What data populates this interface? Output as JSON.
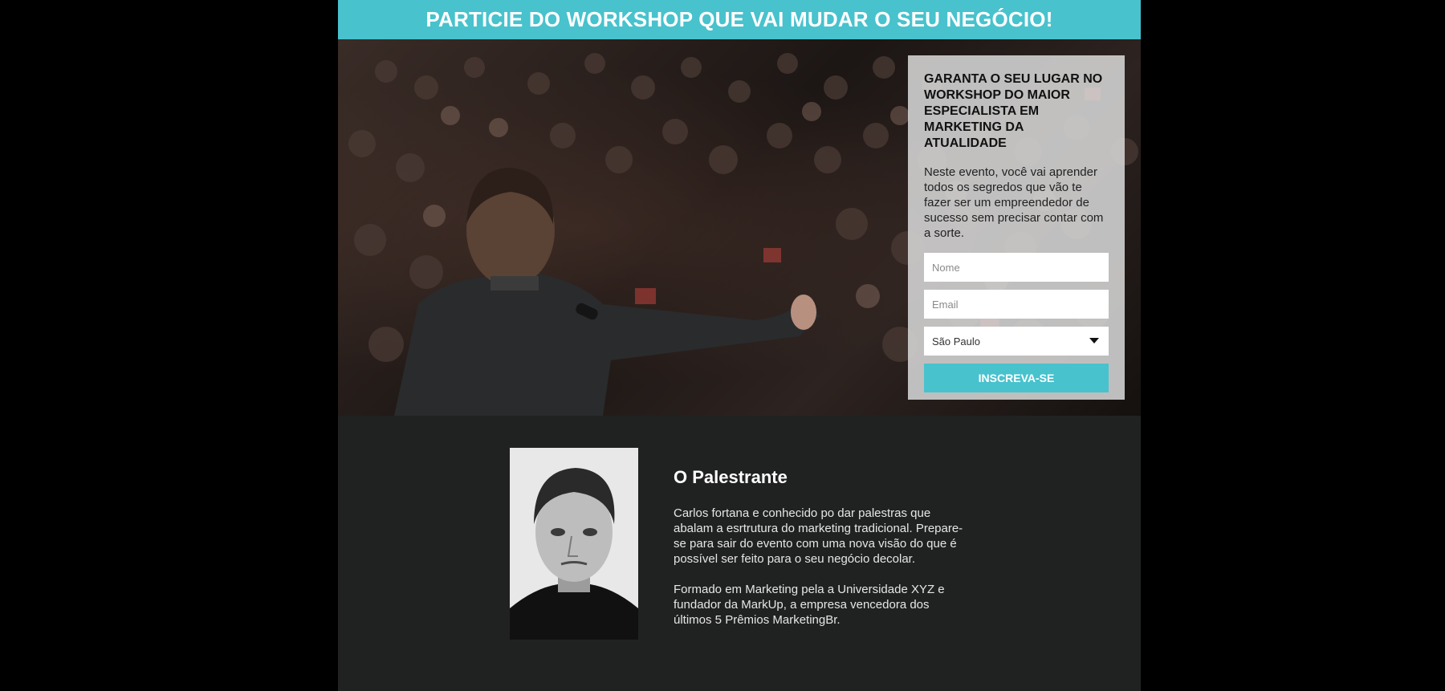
{
  "banner": {
    "title": "PARTICIE DO WORKSHOP QUE VAI MUDAR O SEU NEGÓCIO!"
  },
  "signup": {
    "heading": "GARANTA O SEU LUGAR NO WORKSHOP DO MAIOR ESPECIALISTA EM MARKETING DA ATUALIDADE",
    "description": "Neste evento, você vai aprender todos os segredos que vão te fazer ser um empreendedor de sucesso sem precisar contar com a sorte.",
    "name_placeholder": "Nome",
    "email_placeholder": "Email",
    "city_selected": "São Paulo",
    "submit_label": "INSCREVA-SE"
  },
  "speaker": {
    "heading": "O Palestrante",
    "bio_paragraph_1": "Carlos fortana e conhecido po dar palestras que abalam a esrtrutura do marketing tradicional. Prepare-se para sair do evento com uma nova visão do que é possível ser feito para o seu negócio decolar.",
    "bio_paragraph_2": "Formado em Marketing pela a Universidade XYZ e fundador da MarkUp, a empresa vencedora dos últimos 5 Prêmios MarketingBr."
  },
  "colors": {
    "accent": "#48c2cd",
    "page_background": "#202221",
    "outer_background": "#000000"
  }
}
